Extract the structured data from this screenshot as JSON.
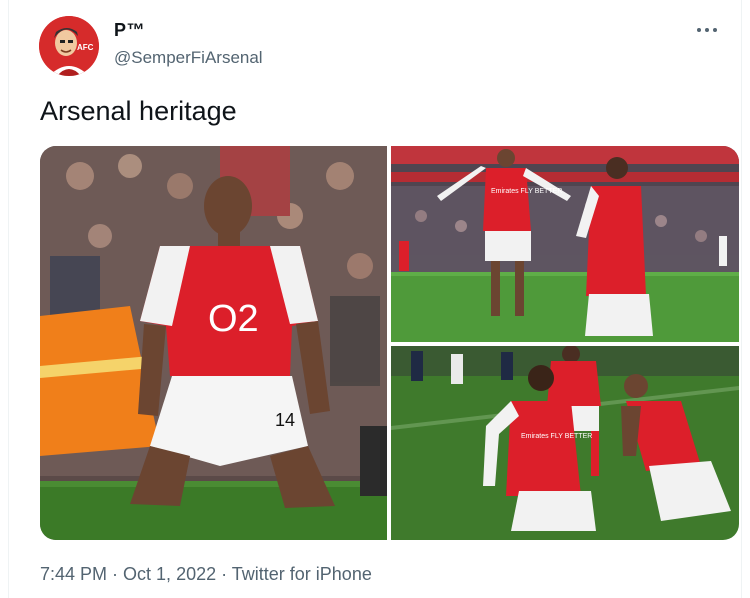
{
  "tweet": {
    "display_name": "P™",
    "handle": "@SemperFiArsenal",
    "text": "Arsenal heritage",
    "time": "7:44 PM",
    "date": "Oct 1, 2022",
    "source": "Twitter for iPhone",
    "separator": " · "
  },
  "avatar": {
    "badge_text": "AFC"
  },
  "photos": [
    {
      "name": "photo-kneeling-celebration",
      "shirt_text": "O2",
      "shirt_number": "14"
    },
    {
      "name": "photo-dancing-celebration",
      "shirt_text": "Emirates FLY BETTER"
    },
    {
      "name": "photo-knee-slide-celebration",
      "shirt_text": "Emirates FLY BETTER"
    }
  ],
  "colors": {
    "accent_red": "#db0007",
    "pitch_green": "#3f7a2c",
    "muted_text": "#536471"
  }
}
